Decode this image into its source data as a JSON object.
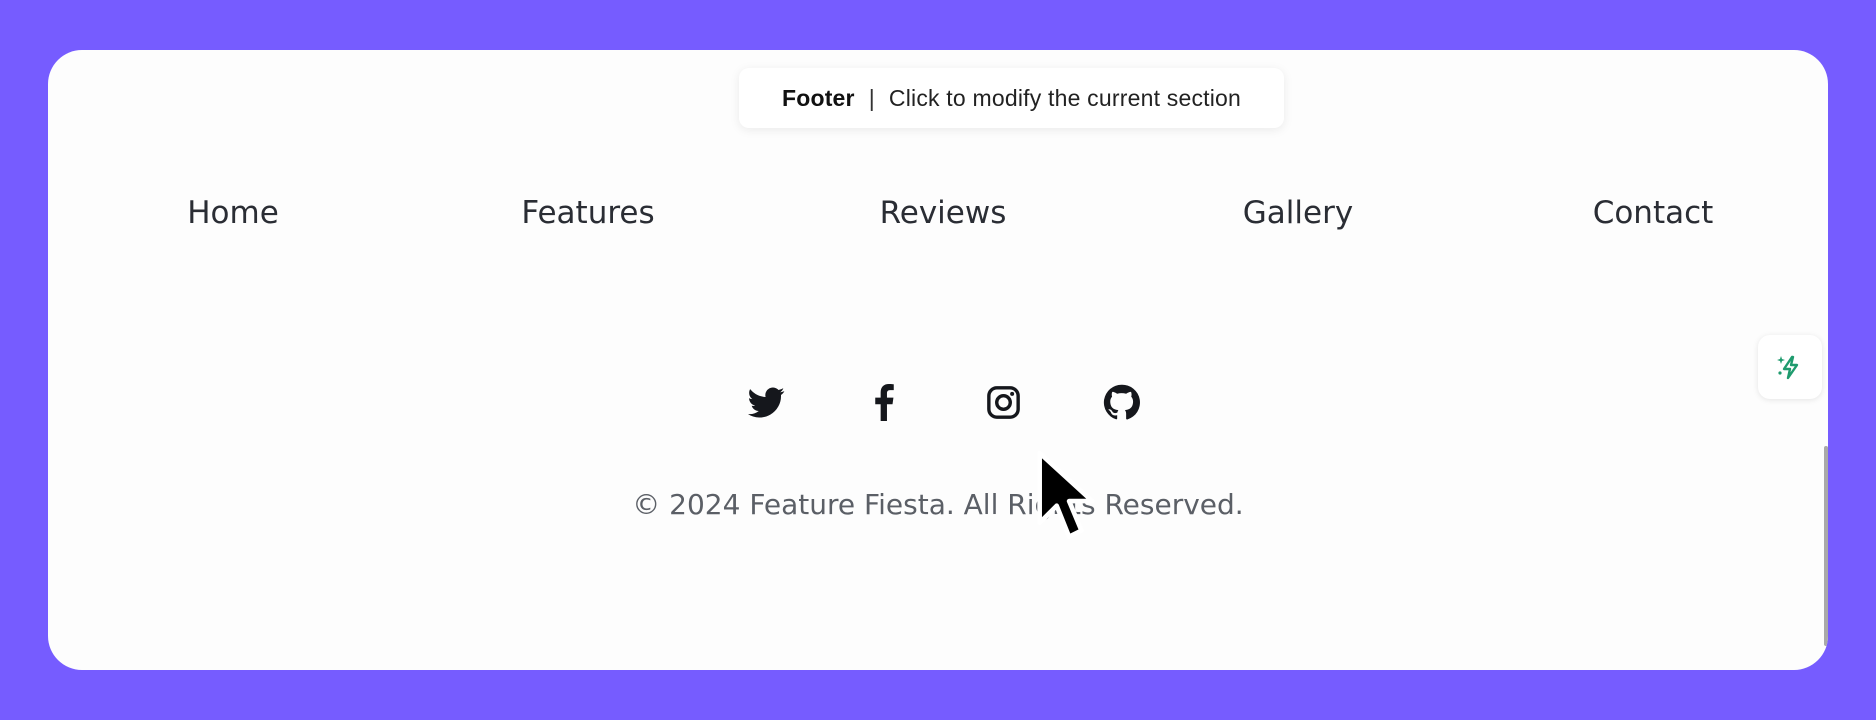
{
  "tooltip": {
    "section_name": "Footer",
    "separator": "|",
    "hint": "Click to modify the current section"
  },
  "nav": {
    "items": [
      {
        "label": "Home"
      },
      {
        "label": "Features"
      },
      {
        "label": "Reviews"
      },
      {
        "label": "Gallery"
      },
      {
        "label": "Contact"
      }
    ]
  },
  "socials": [
    {
      "icon": "twitter-icon"
    },
    {
      "icon": "facebook-icon"
    },
    {
      "icon": "instagram-icon"
    },
    {
      "icon": "github-icon"
    }
  ],
  "footer": {
    "copyright": "© 2024 Feature Fiesta. All Rights Reserved."
  },
  "ai_button": {
    "icon": "sparkle-bolt-icon"
  },
  "colors": {
    "background": "#765cff",
    "card": "#fdfdfd",
    "nav_text": "#2a2d34",
    "copyright_text": "#5b5f66",
    "ai_accent": "#1f9b6e"
  }
}
